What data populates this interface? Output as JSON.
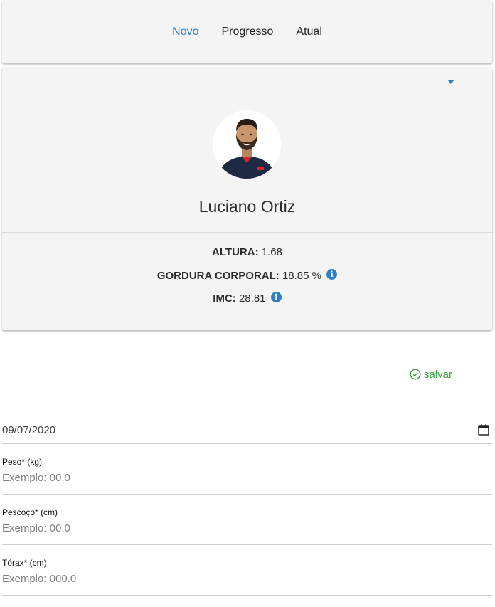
{
  "nav": {
    "tabs": [
      {
        "label": "Novo"
      },
      {
        "label": "Progresso"
      },
      {
        "label": "Atual"
      }
    ],
    "active_tab": "Novo"
  },
  "profile": {
    "name": "Luciano Ortiz",
    "menu_icon": "caret-down-icon",
    "stats": {
      "altura": {
        "label": "ALTURA:",
        "value": "1.68"
      },
      "gordura": {
        "label": "GORDURA CORPORAL:",
        "value": "18.85 %"
      },
      "imc": {
        "label": "IMC:",
        "value": "28.81"
      }
    },
    "info_icon": "info-icon"
  },
  "actions": {
    "save_label": "salvar",
    "save_icon": "check-circle-icon"
  },
  "form": {
    "date_value": "09/07/2020",
    "date_icon": "calendar-icon",
    "fields": [
      {
        "label": "Peso* (kg)",
        "placeholder": "Exemplo: 00.0"
      },
      {
        "label": "Pescoço* (cm)",
        "placeholder": "Exemplo: 00.0"
      },
      {
        "label": "Tórax* (cm)",
        "placeholder": "Exemplo: 000.0"
      }
    ]
  },
  "colors": {
    "accent": "#2f7fc4",
    "success": "#3a9c43",
    "card_bg": "#f4f4f4"
  }
}
